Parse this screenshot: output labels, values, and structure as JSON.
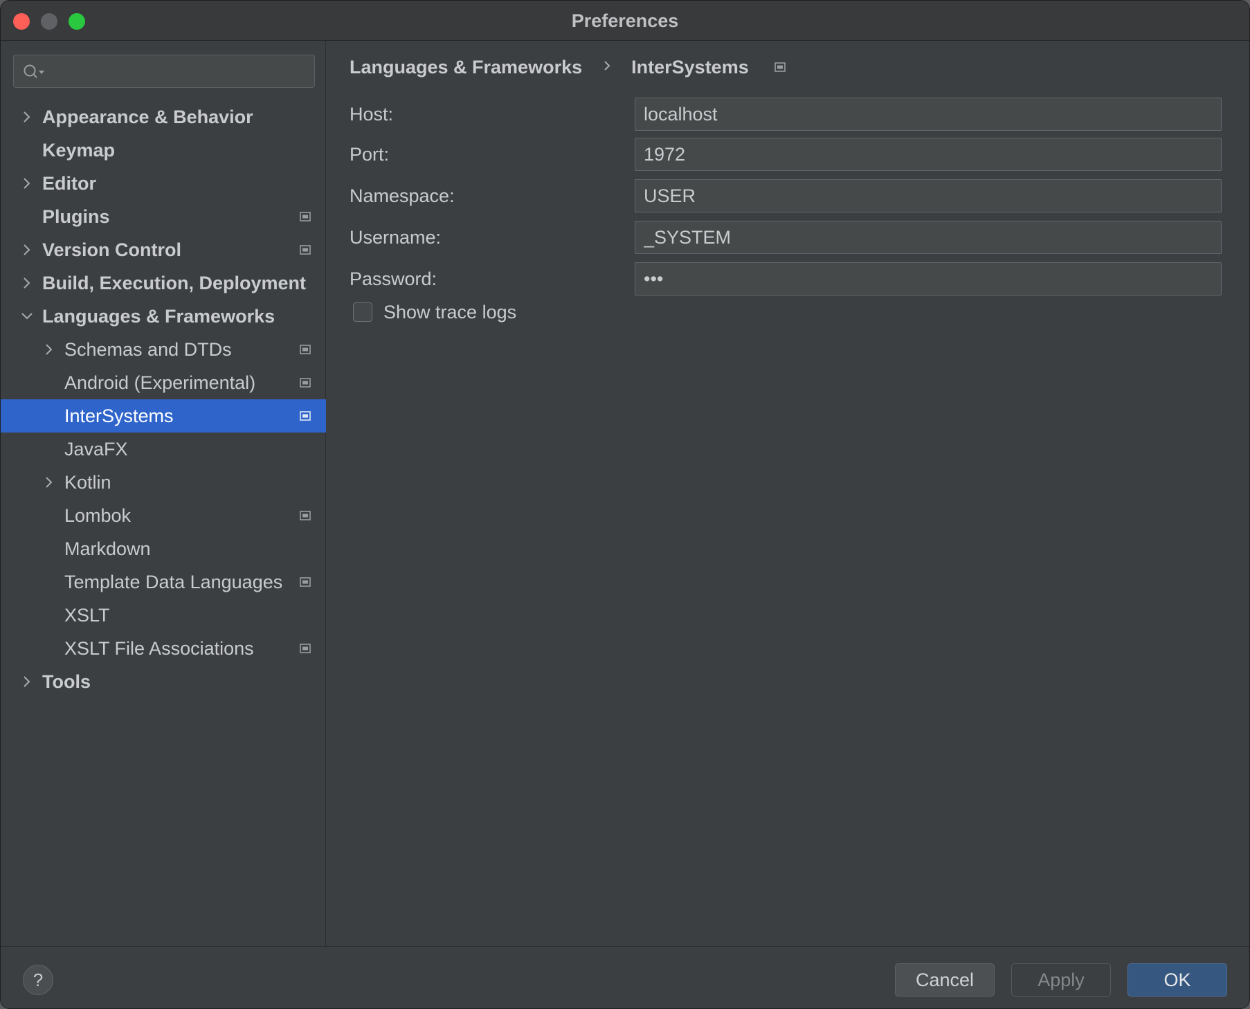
{
  "window": {
    "title": "Preferences"
  },
  "sidebar": {
    "search_placeholder": "",
    "items": [
      {
        "label": "Appearance & Behavior",
        "level": 0,
        "bold": true,
        "chevron": "right",
        "project": false
      },
      {
        "label": "Keymap",
        "level": 0,
        "bold": true,
        "chevron": "none",
        "project": false
      },
      {
        "label": "Editor",
        "level": 0,
        "bold": true,
        "chevron": "right",
        "project": false
      },
      {
        "label": "Plugins",
        "level": 0,
        "bold": true,
        "chevron": "none",
        "project": true
      },
      {
        "label": "Version Control",
        "level": 0,
        "bold": true,
        "chevron": "right",
        "project": true
      },
      {
        "label": "Build, Execution, Deployment",
        "level": 0,
        "bold": true,
        "chevron": "right",
        "project": false
      },
      {
        "label": "Languages & Frameworks",
        "level": 0,
        "bold": true,
        "chevron": "down",
        "project": false
      },
      {
        "label": "Schemas and DTDs",
        "level": 1,
        "bold": false,
        "chevron": "right",
        "project": true
      },
      {
        "label": "Android (Experimental)",
        "level": 1,
        "bold": false,
        "chevron": "none",
        "project": true
      },
      {
        "label": "InterSystems",
        "level": 1,
        "bold": false,
        "chevron": "none",
        "project": true,
        "selected": true
      },
      {
        "label": "JavaFX",
        "level": 1,
        "bold": false,
        "chevron": "none",
        "project": false
      },
      {
        "label": "Kotlin",
        "level": 1,
        "bold": false,
        "chevron": "right",
        "project": false
      },
      {
        "label": "Lombok",
        "level": 1,
        "bold": false,
        "chevron": "none",
        "project": true
      },
      {
        "label": "Markdown",
        "level": 1,
        "bold": false,
        "chevron": "none",
        "project": false
      },
      {
        "label": "Template Data Languages",
        "level": 1,
        "bold": false,
        "chevron": "none",
        "project": true
      },
      {
        "label": "XSLT",
        "level": 1,
        "bold": false,
        "chevron": "none",
        "project": false
      },
      {
        "label": "XSLT File Associations",
        "level": 1,
        "bold": false,
        "chevron": "none",
        "project": true
      },
      {
        "label": "Tools",
        "level": 0,
        "bold": true,
        "chevron": "right",
        "project": false
      }
    ]
  },
  "breadcrumb": {
    "parent": "Languages & Frameworks",
    "current": "InterSystems"
  },
  "form": {
    "host": {
      "label": "Host:",
      "value": "localhost"
    },
    "port": {
      "label": "Port:",
      "value": "1972"
    },
    "namespace": {
      "label": "Namespace:",
      "value": "USER"
    },
    "username": {
      "label": "Username:",
      "value": "_SYSTEM"
    },
    "password": {
      "label": "Password:",
      "value": "•••"
    },
    "trace": {
      "label": "Show trace logs",
      "checked": false
    }
  },
  "footer": {
    "help": "?",
    "cancel": "Cancel",
    "apply": "Apply",
    "ok": "OK"
  }
}
